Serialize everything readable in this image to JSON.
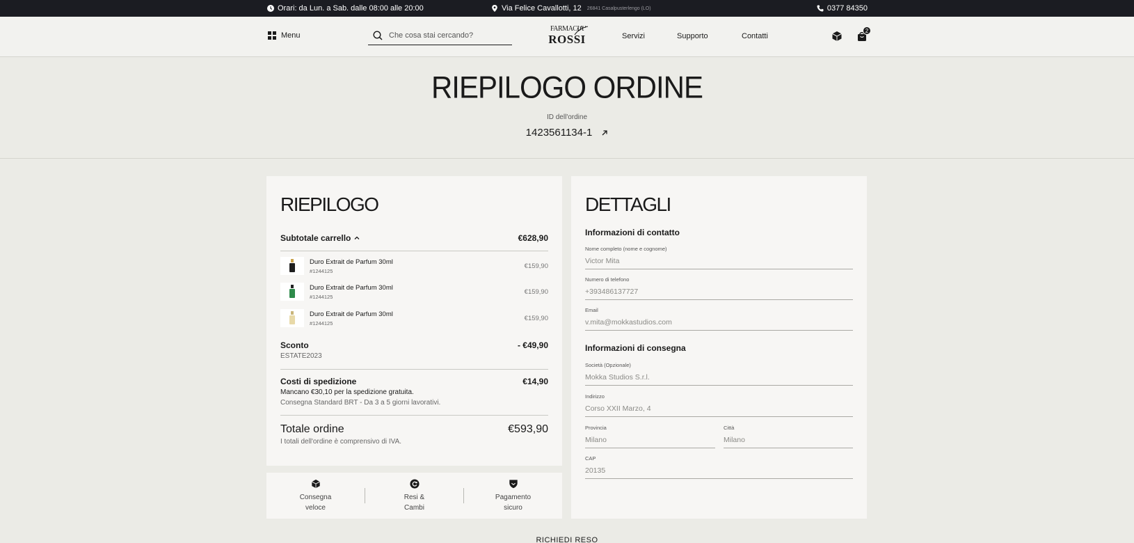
{
  "topbar": {
    "hours": "Orari: da Lun. a Sab. dalle 08:00 alle 20:00",
    "address": "Via Felice Cavallotti, 12",
    "address_small": "26841 Casalpusterlengo (LO)",
    "phone": "0377 84350"
  },
  "header": {
    "menu_label": "Menu",
    "search_placeholder": "Che cosa stai cercando?",
    "logo_line1": "FARMACIA",
    "logo_line2": "ROSSI",
    "nav": [
      "Servizi",
      "Supporto",
      "Contatti"
    ],
    "cart_count": "2"
  },
  "page": {
    "title": "RIEPILOGO ORDINE",
    "order_label": "ID dell'ordine",
    "order_id": "1423561134-1"
  },
  "summary": {
    "title": "RIEPILOGO",
    "subtotal_label": "Subtotale carrello",
    "subtotal_value": "€628,90",
    "products": [
      {
        "name": "Duro Extrait de Parfum 30ml",
        "sku": "#1244125",
        "price": "€159,90",
        "bottle_color": "#1e1e1e",
        "cap_color": "#c9a24a"
      },
      {
        "name": "Duro Extrait de Parfum 30ml",
        "sku": "#1244125",
        "price": "€159,90",
        "bottle_color": "#2e8a4a",
        "cap_color": "#222222"
      },
      {
        "name": "Duro Extrait de Parfum 30ml",
        "sku": "#1244125",
        "price": "€159,90",
        "bottle_color": "#e8d9a8",
        "cap_color": "#c9b57a"
      }
    ],
    "discount_label": "Sconto",
    "discount_code": "ESTATE2023",
    "discount_value": "- €49,90",
    "shipping_label": "Costi di spedizione",
    "shipping_value": "€14,90",
    "shipping_note": "Mancano €30,10 per la spedizione gratuita.",
    "shipping_method": "Consegna Standard BRT - Da 3 a 5 giorni lavorativi.",
    "total_label": "Totale ordine",
    "total_value": "€593,90",
    "total_note": "I totali dell'ordine è comprensivo di IVA."
  },
  "features": [
    {
      "line1": "Consegna",
      "line2": "veloce",
      "icon": "box-icon"
    },
    {
      "line1": "Resi &",
      "line2": "Cambi",
      "icon": "return-icon"
    },
    {
      "line1": "Pagamento",
      "line2": "sicuro",
      "icon": "shield-icon"
    }
  ],
  "details": {
    "title": "DETTAGLI",
    "contact_head": "Informazioni di contatto",
    "name_label": "Nome completo (nome e cognome)",
    "name_value": "Victor Mita",
    "phone_label": "Numero di telefono",
    "phone_value": "+393486137727",
    "email_label": "Email",
    "email_value": "v.mita@mokkastudios.com",
    "delivery_head": "Informazioni di consegna",
    "company_label": "Società (Opzionale)",
    "company_value": "Mokka Studios S.r.l.",
    "address_label": "Indirizzo",
    "address_value": "Corso XXII Marzo, 4",
    "province_label": "Provincia",
    "province_value": "Milano",
    "city_label": "Città",
    "city_value": "Milano",
    "cap_label": "CAP",
    "cap_value": "20135"
  },
  "footer": {
    "return_link": "RICHIEDI RESO"
  }
}
